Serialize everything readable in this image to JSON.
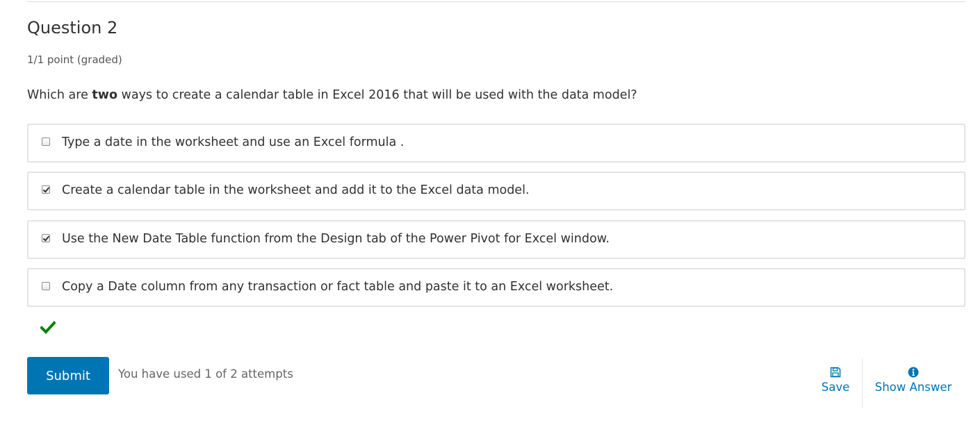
{
  "question": {
    "title": "Question 2",
    "points": "1/1 point (graded)",
    "prompt_before": "Which are ",
    "prompt_bold": "two",
    "prompt_after": " ways to create a calendar table in Excel 2016 that will be used with the data model?"
  },
  "choices": [
    {
      "label": "Type a date in the worksheet and use an Excel formula .",
      "checked": false
    },
    {
      "label": "Create a calendar table in the worksheet and add it to the Excel data model.",
      "checked": true
    },
    {
      "label": "Use the New Date Table function from the Design tab of the Power Pivot for Excel window.",
      "checked": true
    },
    {
      "label": "Copy a Date column from any transaction or fact table and paste it to an Excel worksheet.",
      "checked": false
    }
  ],
  "status": {
    "icon": "checkmark-icon",
    "color": "#008100"
  },
  "actions": {
    "submit_label": "Submit",
    "attempts_text": "You have used 1 of 2 attempts",
    "save_label": "Save",
    "save_icon": "floppy-disk-icon",
    "show_answer_label": "Show Answer",
    "show_answer_icon": "info-circle-icon"
  },
  "colors": {
    "accent": "#0075b4",
    "border": "#e4e4e4",
    "text": "#313131",
    "muted": "#646464"
  }
}
